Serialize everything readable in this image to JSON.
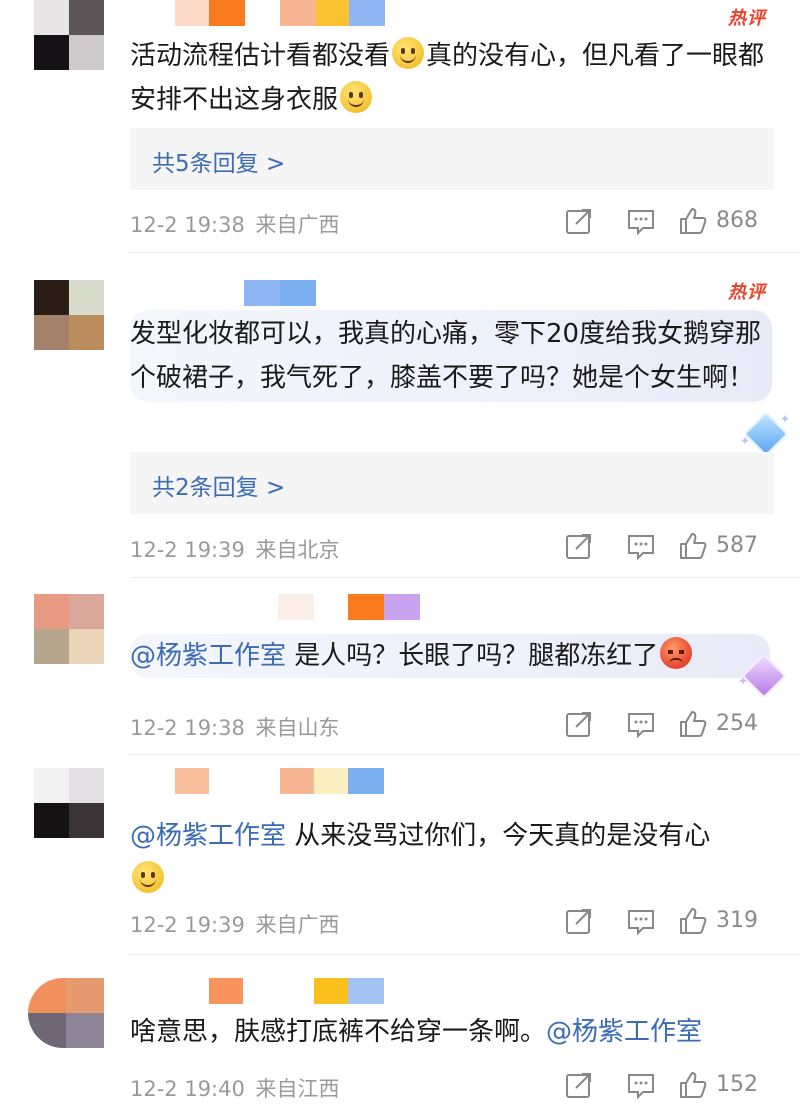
{
  "comments": [
    {
      "hot_label": "热评",
      "text_parts": [
        "活动流程估计看都没看",
        "真的没有心，但凡看了一眼都安排不出这身衣服"
      ],
      "reply_label": "共5条回复 >",
      "time": "12-2 19:38",
      "location": "来自广西",
      "likes": "868"
    },
    {
      "hot_label": "热评",
      "text": "发型化妆都可以，我真的心痛，零下20度给我女鹅穿那个破裙子，我气死了，膝盖不要了吗？她是个女生啊！",
      "reply_label": "共2条回复 >",
      "time": "12-2 19:39",
      "location": "来自北京",
      "likes": "587"
    },
    {
      "mention": "@杨紫工作室",
      "text": " 是人吗？长眼了吗？腿都冻红了",
      "time": "12-2 19:38",
      "location": "来自山东",
      "likes": "254"
    },
    {
      "mention": "@杨紫工作室",
      "text": " 从来没骂过你们，今天真的是没有心",
      "time": "12-2 19:39",
      "location": "来自广西",
      "likes": "319"
    },
    {
      "text": "啥意思，肤感打底裤不给穿一条啊。",
      "mention": "@杨紫工作室",
      "time": "12-2 19:40",
      "location": "来自江西",
      "likes": "152"
    }
  ],
  "icons": {
    "share": "share-icon",
    "comment": "comment-icon",
    "like": "thumbs-up-icon",
    "smile": "smile-emoji-icon",
    "angry": "angry-emoji-icon",
    "gem": "diamond-badge-icon"
  },
  "colors": {
    "link": "#3b6cb4",
    "hot": "#e8452e",
    "meta": "#9a9a9a",
    "reply_bg": "#f5f5f5"
  }
}
